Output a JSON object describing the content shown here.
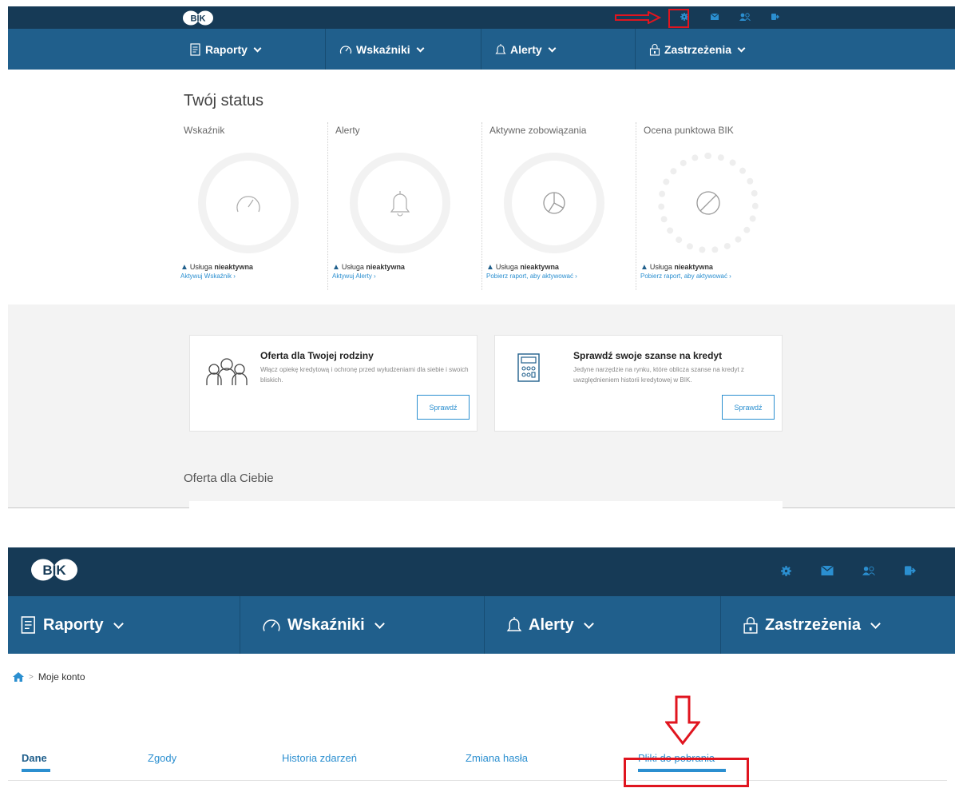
{
  "panel1": {
    "logo": "BIK",
    "nav": [
      {
        "label": "Raporty",
        "icon": "document-icon"
      },
      {
        "label": "Wskaźniki",
        "icon": "gauge-icon"
      },
      {
        "label": "Alerty",
        "icon": "bell-icon"
      },
      {
        "label": "Zastrzeżenia",
        "icon": "padlock-icon"
      }
    ],
    "status_title": "Twój status",
    "status": [
      {
        "label": "Wskaźnik",
        "warn_prefix": "Usługa ",
        "warn_strong": "nieaktywna",
        "action": "Aktywuj Wskaźnik ›"
      },
      {
        "label": "Alerty",
        "warn_prefix": "Usługa ",
        "warn_strong": "nieaktywna",
        "action": "Aktywuj Alerty ›"
      },
      {
        "label": "Aktywne zobowiązania",
        "warn_prefix": "Usługa ",
        "warn_strong": "nieaktywna",
        "action": "Pobierz raport, aby aktywować ›"
      },
      {
        "label": "Ocena punktowa BIK",
        "warn_prefix": "Usługa ",
        "warn_strong": "nieaktywna",
        "action": "Pobierz raport, aby aktywować ›"
      }
    ],
    "cards": [
      {
        "title": "Oferta dla Twojej rodziny",
        "desc": "Włącz opiekę kredytową i ochronę przed wyłudzeniami dla siebie i swoich bliskich.",
        "button": "Sprawdź"
      },
      {
        "title": "Sprawdź swoje szanse na kredyt",
        "desc": "Jedyne narzędzie na rynku, które oblicza szanse na kredyt z uwzględnieniem historii kredytowej w BIK.",
        "button": "Sprawdź"
      }
    ],
    "offer_title": "Oferta dla Ciebie"
  },
  "panel2": {
    "logo": "BIK",
    "nav": [
      {
        "label": "Raporty"
      },
      {
        "label": "Wskaźniki"
      },
      {
        "label": "Alerty"
      },
      {
        "label": "Zastrzeżenia"
      }
    ],
    "breadcrumb": {
      "separator": ">",
      "current": "Moje konto"
    },
    "tabs": [
      {
        "label": "Dane",
        "active": true
      },
      {
        "label": "Zgody"
      },
      {
        "label": "Historia zdarzeń"
      },
      {
        "label": "Zmiana hasła"
      },
      {
        "label": "Pliki do pobrania",
        "highlighted": true
      }
    ]
  },
  "colors": {
    "top_bar": "#163a56",
    "nav_bar": "#205f8c",
    "accent": "#2b8fd0",
    "annotation": "#e0151f",
    "icon": "#2b8fd0"
  }
}
